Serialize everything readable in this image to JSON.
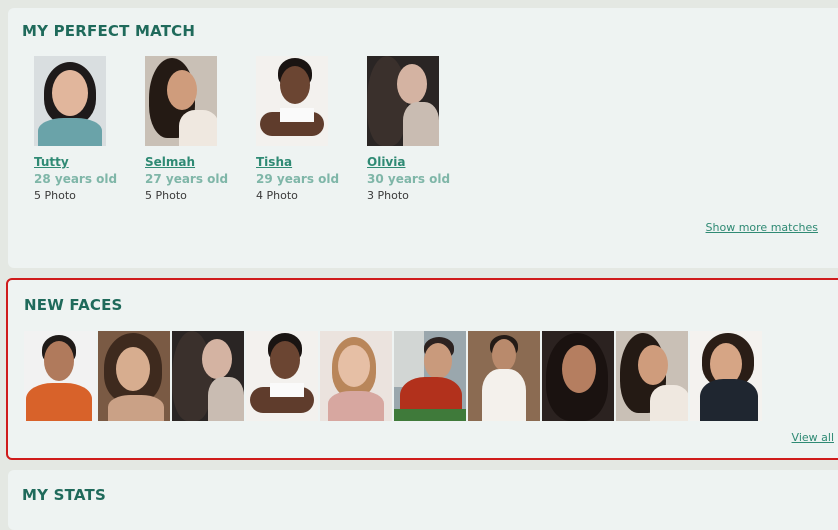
{
  "perfect_match": {
    "title": "MY PERFECT MATCH",
    "matches": [
      {
        "name": "Tutty",
        "age": "28 years old",
        "photos": "5 Photo"
      },
      {
        "name": "Selmah",
        "age": "27 years old",
        "photos": "5 Photo"
      },
      {
        "name": "Tisha",
        "age": "29 years old",
        "photos": "4 Photo"
      },
      {
        "name": "Olivia",
        "age": "30 years old",
        "photos": "3 Photo"
      }
    ],
    "more_link": "Show more matches"
  },
  "new_faces": {
    "title": "NEW FACES",
    "view_all": "View all"
  },
  "stats": {
    "title": "MY STATS"
  }
}
